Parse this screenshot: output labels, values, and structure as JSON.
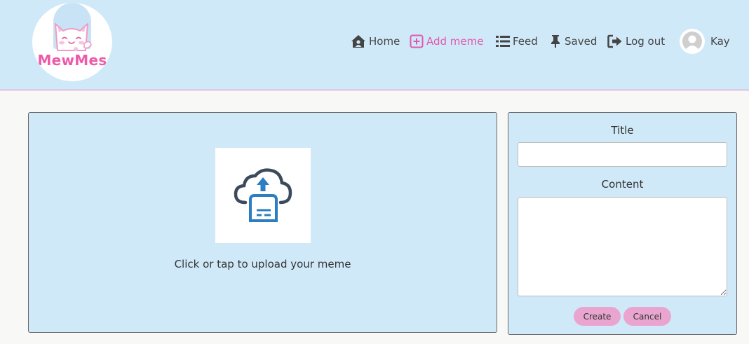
{
  "header": {
    "logo_text": "MewMes",
    "nav": [
      {
        "label": "Home",
        "icon": "home-icon"
      },
      {
        "label": "Add meme",
        "icon": "plus-square-icon",
        "active": true
      },
      {
        "label": "Feed",
        "icon": "list-icon"
      },
      {
        "label": "Saved",
        "icon": "pin-icon"
      },
      {
        "label": "Log out",
        "icon": "sign-out-icon"
      }
    ],
    "user_name": "Kay"
  },
  "upload": {
    "prompt": "Click or tap to upload your meme"
  },
  "form": {
    "title_label": "Title",
    "title_value": "",
    "content_label": "Content",
    "content_value": "",
    "create_label": "Create",
    "cancel_label": "Cancel"
  },
  "colors": {
    "header_bg": "#d0e9f8",
    "accent_pink": "#e05aae",
    "button_pink": "#e9a5cf",
    "page_bg": "#f8f8f6"
  }
}
